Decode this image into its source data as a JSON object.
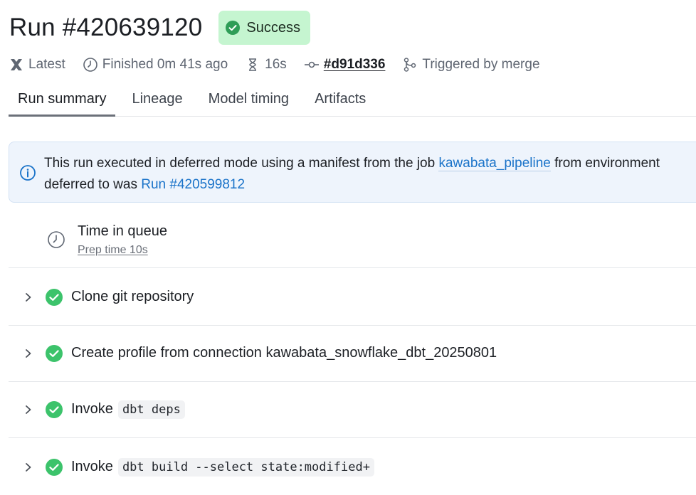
{
  "header": {
    "title": "Run #420639120",
    "status": "Success",
    "status_color": "#c5f5d0"
  },
  "meta": {
    "latest_label": "Latest",
    "finished_label": "Finished 0m 41s ago",
    "duration_label": "16s",
    "commit_label": "#d91d336",
    "trigger_label": "Triggered by merge"
  },
  "tabs": [
    {
      "label": "Run summary",
      "active": true
    },
    {
      "label": "Lineage",
      "active": false
    },
    {
      "label": "Model timing",
      "active": false
    },
    {
      "label": "Artifacts",
      "active": false
    }
  ],
  "info_banner": {
    "text_1": "This run executed in deferred mode using a manifest from the job ",
    "job_link": "kawabata_pipeline",
    "text_2": " from environment",
    "text_3": "deferred to was ",
    "run_link": "Run #420599812"
  },
  "queue": {
    "title": "Time in queue",
    "subtitle": "Prep time 10s"
  },
  "steps": [
    {
      "label": "Clone git repository",
      "code": ""
    },
    {
      "label": "Create profile from connection kawabata_snowflake_dbt_20250801",
      "code": ""
    },
    {
      "label": "Invoke",
      "code": "dbt deps"
    },
    {
      "label": "Invoke",
      "code": "dbt build --select state:modified+"
    }
  ],
  "colors": {
    "success_green": "#3cc36b",
    "link_blue": "#1a73c9",
    "info_bg": "#eef4fc"
  },
  "icons": {
    "latest": "dbt-logo-icon",
    "finished": "clock-icon",
    "duration": "hourglass-icon",
    "commit": "commit-icon",
    "trigger": "git-merge-icon",
    "info": "info-icon"
  }
}
